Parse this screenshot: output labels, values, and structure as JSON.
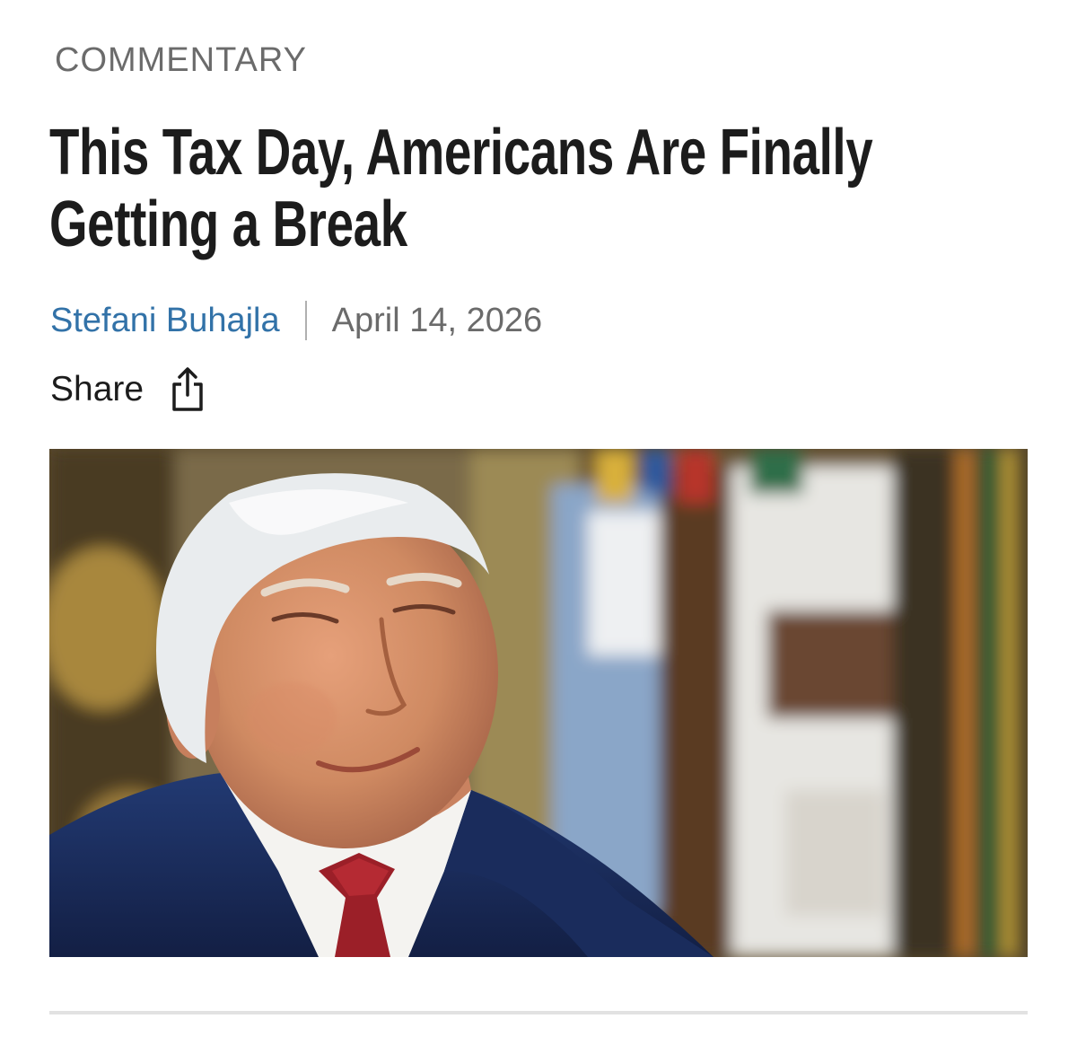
{
  "article": {
    "kicker": "COMMENTARY",
    "headline": "This Tax Day, Americans Are Finally Getting a Break",
    "author": "Stefani Buhajla",
    "date": "April 14, 2026",
    "share_label": "Share",
    "share_icon": "share-icon",
    "colors": {
      "author_link": "#3272a8",
      "kicker": "#6b6b6b",
      "headline": "#1c1c1c"
    }
  }
}
